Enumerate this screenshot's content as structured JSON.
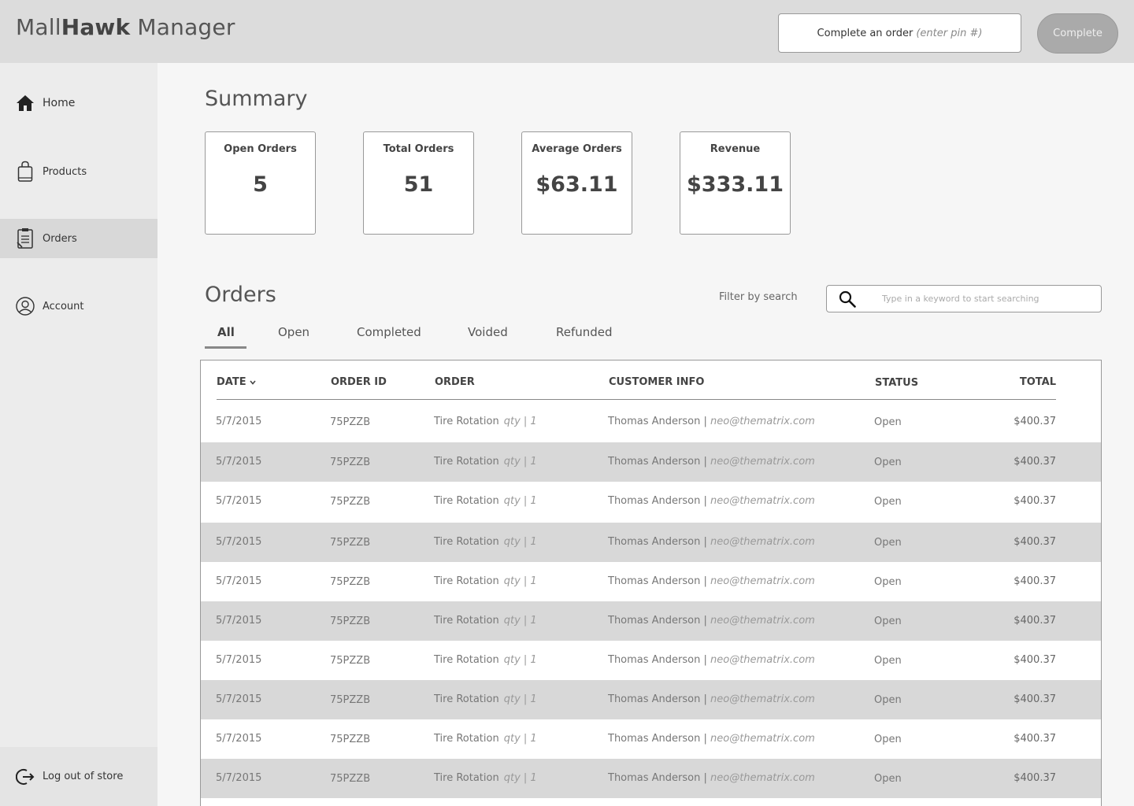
{
  "header": {
    "logo_prefix": "Mall",
    "logo_bold": "Hawk",
    "logo_suffix": " Manager",
    "pin_label": "Complete an order",
    "pin_hint": "(enter pin #)",
    "complete_label": "Complete"
  },
  "sidebar": {
    "items": [
      {
        "label": "Home",
        "icon": "home-icon"
      },
      {
        "label": "Products",
        "icon": "shopping-bag-icon"
      },
      {
        "label": "Orders",
        "icon": "clipboard-icon"
      },
      {
        "label": "Account",
        "icon": "user-icon"
      }
    ],
    "active": "Orders",
    "logout_label": "Log out of store"
  },
  "summary": {
    "title": "Summary",
    "cards": [
      {
        "label": "Open Orders",
        "value": "5"
      },
      {
        "label": "Total Orders",
        "value": "51"
      },
      {
        "label": "Average Orders",
        "value": "$63.11"
      },
      {
        "label": "Revenue",
        "value": "$333.11"
      }
    ]
  },
  "orders": {
    "title": "Orders",
    "filter_label": "Filter by search",
    "search_placeholder": "Type in a keyword to start searching",
    "tabs": [
      "All",
      "Open",
      "Completed",
      "Voided",
      "Refunded"
    ],
    "active_tab": "All",
    "columns": [
      "DATE",
      "ORDER ID",
      "ORDER",
      "CUSTOMER INFO",
      "STATUS",
      "TOTAL"
    ],
    "rows": [
      {
        "date": "5/7/2015",
        "id": "75PZZB",
        "order": "Tire Rotation",
        "qty": "qty  |  1",
        "customer": "Thomas Anderson |",
        "email": "neo@thematrix.com",
        "status": "Open",
        "total": "$400.37"
      },
      {
        "date": "5/7/2015",
        "id": "75PZZB",
        "order": "Tire Rotation",
        "qty": "qty  |  1",
        "customer": "Thomas Anderson |",
        "email": "neo@thematrix.com",
        "status": "Open",
        "total": "$400.37"
      },
      {
        "date": "5/7/2015",
        "id": "75PZZB",
        "order": "Tire Rotation",
        "qty": "qty  |  1",
        "customer": "Thomas Anderson |",
        "email": "neo@thematrix.com",
        "status": "Open",
        "total": "$400.37"
      },
      {
        "date": "5/7/2015",
        "id": "75PZZB",
        "order": "Tire Rotation",
        "qty": "qty  |  1",
        "customer": "Thomas Anderson |",
        "email": "neo@thematrix.com",
        "status": "Open",
        "total": "$400.37"
      },
      {
        "date": "5/7/2015",
        "id": "75PZZB",
        "order": "Tire Rotation",
        "qty": "qty  |  1",
        "customer": "Thomas Anderson |",
        "email": "neo@thematrix.com",
        "status": "Open",
        "total": "$400.37"
      },
      {
        "date": "5/7/2015",
        "id": "75PZZB",
        "order": "Tire Rotation",
        "qty": "qty  |  1",
        "customer": "Thomas Anderson |",
        "email": "neo@thematrix.com",
        "status": "Open",
        "total": "$400.37"
      },
      {
        "date": "5/7/2015",
        "id": "75PZZB",
        "order": "Tire Rotation",
        "qty": "qty  |  1",
        "customer": "Thomas Anderson |",
        "email": "neo@thematrix.com",
        "status": "Open",
        "total": "$400.37"
      },
      {
        "date": "5/7/2015",
        "id": "75PZZB",
        "order": "Tire Rotation",
        "qty": "qty  |  1",
        "customer": "Thomas Anderson |",
        "email": "neo@thematrix.com",
        "status": "Open",
        "total": "$400.37"
      },
      {
        "date": "5/7/2015",
        "id": "75PZZB",
        "order": "Tire Rotation",
        "qty": "qty  |  1",
        "customer": "Thomas Anderson |",
        "email": "neo@thematrix.com",
        "status": "Open",
        "total": "$400.37"
      },
      {
        "date": "5/7/2015",
        "id": "75PZZB",
        "order": "Tire Rotation",
        "qty": "qty  |  1",
        "customer": "Thomas Anderson |",
        "email": "neo@thematrix.com",
        "status": "Open",
        "total": "$400.37"
      }
    ]
  },
  "colors": {
    "header_bg": "#dcdcdc",
    "sidebar_bg": "#ececec",
    "active_nav_bg": "#d8d8d8",
    "row_alt_bg": "#d8d8d8",
    "complete_button_bg": "#aaaaaa"
  }
}
